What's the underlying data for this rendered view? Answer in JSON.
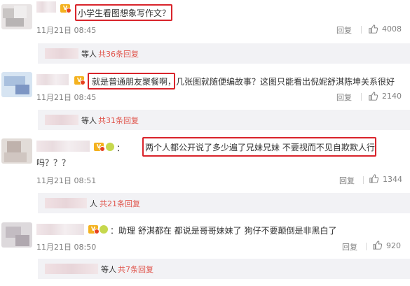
{
  "comments": [
    {
      "text": "小学生看图想象写作文？",
      "time": "11月21日 08:45",
      "reply_label": "回复",
      "likes": "4008",
      "thread": {
        "prefix": "等人",
        "count": "共36条回复"
      }
    },
    {
      "highlight": "就是普通朋友聚餐啊",
      "text_rest": "，几张图就随便编故事？这图只能看出倪妮舒淇陈坤关系很好",
      "time": "11月21日 08:45",
      "reply_label": "回复",
      "likes": "2140",
      "thread": {
        "prefix": "等人",
        "count": "共31条回复"
      }
    },
    {
      "prefix": "：",
      "highlight": "两个人都公开说了多少遍了兄妹兄妹 不要视而不见自欺欺人行",
      "line2": "吗？？？",
      "time": "11月21日 08:51",
      "reply_label": "回复",
      "likes": "1344",
      "thread": {
        "prefix": "人",
        "count": "共21条回复"
      }
    },
    {
      "text": "：助理 舒淇都在 都说是哥哥妹妹了 狗仔不要颠倒是非黑白了",
      "time": "11月21日 08:50",
      "reply_label": "回复",
      "likes": "920",
      "thread": {
        "prefix": "等人",
        "count": "共7条回复"
      }
    }
  ],
  "icons": {
    "like": "thumbs-up-icon",
    "vip": "vip-badge-icon",
    "badge": "green-badge-icon"
  },
  "colors": {
    "highlight_border": "#d9242b",
    "reply_count": "#e0544b",
    "meta": "#808080"
  }
}
